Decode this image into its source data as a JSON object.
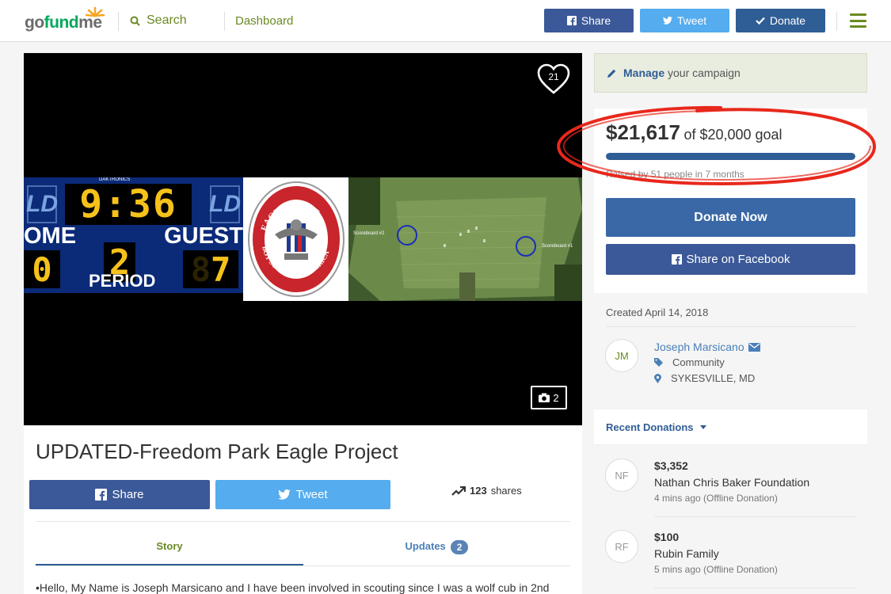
{
  "header": {
    "logo_go": "go",
    "logo_fund": "fund",
    "logo_me": "me",
    "search_label": "Search",
    "dashboard_label": "Dashboard",
    "share_label": "Share",
    "tweet_label": "Tweet",
    "donate_label": "Donate"
  },
  "media": {
    "heart_count": "21",
    "photo_count": "2",
    "scoreboard": {
      "brand": "DAKTRONICS",
      "time": "9:36",
      "home": "OME",
      "guest": "GUEST",
      "period_num": "2",
      "period_label": "PERIOD",
      "home_score": "0",
      "guest_score": "7",
      "ld": "LD"
    },
    "eagle_top": "EAGLE SCOUT",
    "eagle_bottom": "BOY SCOUTS OF AMERICA",
    "aerial_label_left": "Scoreboard #2",
    "aerial_label_right": "Scoreboard #1"
  },
  "campaign": {
    "title": "UPDATED-Freedom Park Eagle Project",
    "share_label": "Share",
    "tweet_label": "Tweet",
    "shares_count": "123",
    "shares_word": "shares",
    "tab_story": "Story",
    "tab_updates": "Updates",
    "updates_count": "2",
    "story_first_line": "•Hello, My Name is Joseph Marsicano and I have been involved in scouting since I was a wolf cub in 2nd"
  },
  "sidebar": {
    "manage_bold": "Manage",
    "manage_rest": "your campaign",
    "raised_amount": "$21,617",
    "raised_goal": "of $20,000 goal",
    "progress_fraction": 1.0,
    "raised_by": "Raised by 51 people in 7 months",
    "donate_now": "Donate Now",
    "share_facebook": "Share on Facebook",
    "created": "Created April 14, 2018",
    "organizer_initials": "JM",
    "organizer_name": "Joseph Marsicano",
    "category": "Community",
    "location": "SYKESVILLE, MD",
    "recent_donations": "Recent Donations",
    "donations": [
      {
        "initials": "NF",
        "amount": "$3,352",
        "name": "Nathan Chris Baker Foundation",
        "time": "4 mins ago (Offline Donation)"
      },
      {
        "initials": "RF",
        "amount": "$100",
        "name": "Rubin Family",
        "time": "5 mins ago (Offline Donation)"
      }
    ]
  },
  "colors": {
    "brand_green": "#02a95c",
    "link_green": "#6a8a23",
    "facebook_blue": "#3b5998",
    "twitter_blue": "#55acee",
    "donate_blue": "#2f5d96",
    "annotation_red": "#e8281c"
  }
}
